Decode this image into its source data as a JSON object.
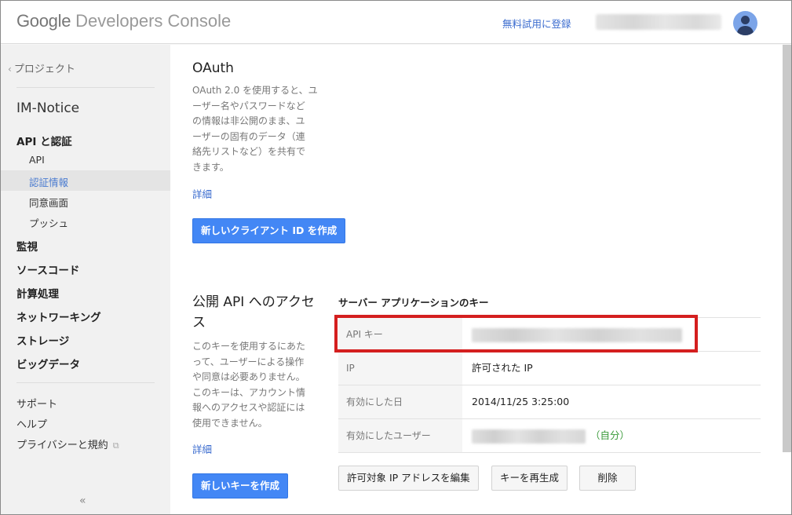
{
  "header": {
    "logo_google": "Google",
    "logo_product": "Developers Console",
    "trial_link": "無料試用に登録"
  },
  "sidebar": {
    "back_label": "プロジェクト",
    "project_name": "IM-Notice",
    "section_api": "API と認証",
    "sub_items": [
      "API",
      "認証情報",
      "同意画面",
      "プッシュ"
    ],
    "active_sub": "認証情報",
    "items": [
      "監視",
      "ソースコード",
      "計算処理",
      "ネットワーキング",
      "ストレージ",
      "ビッグデータ"
    ],
    "footer": [
      "サポート",
      "ヘルプ",
      "プライバシーと規約"
    ],
    "collapse": "«"
  },
  "oauth": {
    "title": "OAuth",
    "description_lines": [
      "OAuth 2.0 を使用すると、ユ",
      "ーザー名やパスワードなど",
      "の情報は非公開のまま、ユ",
      "ーザーの固有のデータ（連",
      "絡先リストなど）を共有で",
      "きます。"
    ],
    "details_link": "詳細",
    "create_button": "新しいクライアント ID を作成"
  },
  "public_api": {
    "title_lines": [
      "公開 API へのアクセ",
      "ス"
    ],
    "description_lines": [
      "このキーを使用するにあた",
      "って、ユーザーによる操作",
      "や同意は必要ありません。",
      "このキーは、アカウント情",
      "報へのアクセスや認証には",
      "使用できません。"
    ],
    "details_link": "詳細",
    "create_button": "新しいキーを作成"
  },
  "server_key": {
    "title": "サーバー アプリケーションのキー",
    "rows": [
      {
        "label": "API キー",
        "value": ""
      },
      {
        "label": "IP",
        "value": "許可された IP"
      },
      {
        "label": "有効にした日",
        "value": "2014/11/25 3:25:00"
      },
      {
        "label": "有効にしたユーザー",
        "value": "",
        "suffix": "（自分）"
      }
    ],
    "buttons": [
      "許可対象 IP アドレスを編集",
      "キーを再生成",
      "削除"
    ]
  },
  "colors": {
    "accent": "#4387f5",
    "link": "#3b6ccf",
    "highlight_box": "#d41f1f",
    "self_tag": "#3a9a3a"
  }
}
